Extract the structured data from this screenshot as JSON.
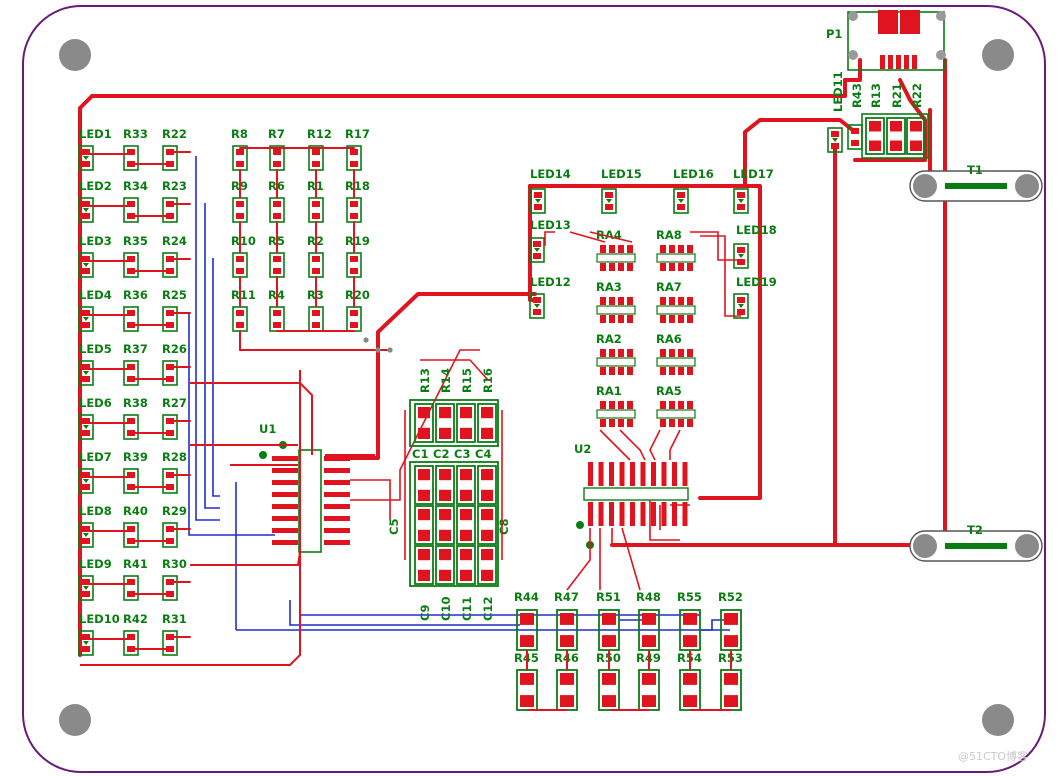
{
  "colors": {
    "outline": "#6a1b7a",
    "trace_top": "#e0141e",
    "trace_bottom": "#1f2fd0",
    "silk": "#0a7d12",
    "hole": "#8a8a8a",
    "pad": "#e0141e",
    "background": "#ffffff"
  },
  "left_column": {
    "leds": [
      "LED1",
      "LED2",
      "LED3",
      "LED4",
      "LED5",
      "LED6",
      "LED7",
      "LED8",
      "LED9",
      "LED10"
    ],
    "res_a": [
      "R33",
      "R34",
      "R35",
      "R36",
      "R37",
      "R38",
      "R39",
      "R40",
      "R41",
      "R42"
    ],
    "res_b": [
      "R22",
      "R23",
      "R24",
      "R25",
      "R26",
      "R27",
      "R28",
      "R29",
      "R30",
      "R31"
    ]
  },
  "resistor_grid": {
    "col1": [
      "R8",
      "R9",
      "R10",
      "R11"
    ],
    "col2": [
      "R7",
      "R6",
      "R5",
      "R4"
    ],
    "col3": [
      "R12",
      "R1",
      "R2",
      "R3"
    ],
    "col4": [
      "R17",
      "R18",
      "R19",
      "R20"
    ]
  },
  "ic": {
    "u1": "U1",
    "u2": "U2"
  },
  "center_block": {
    "top_res": [
      "R13",
      "R14",
      "R15",
      "R16"
    ],
    "caps_top": [
      "C1",
      "C2",
      "C3",
      "C4"
    ],
    "caps_bottom": [
      "C9",
      "C10",
      "C11",
      "C12"
    ],
    "side_left": "C5",
    "side_right": "C8"
  },
  "right_leds": {
    "top": [
      "LED14",
      "LED15",
      "LED16",
      "LED17"
    ],
    "left": [
      "LED13",
      "LED12"
    ],
    "right": [
      "LED18",
      "LED19"
    ]
  },
  "arrays": {
    "left": [
      "RA4",
      "RA3",
      "RA2",
      "RA1"
    ],
    "right": [
      "RA8",
      "RA7",
      "RA6",
      "RA5"
    ]
  },
  "bottom_res": {
    "top": [
      "R44",
      "R47",
      "R51",
      "R48",
      "R55",
      "R52"
    ],
    "bottom": [
      "R45",
      "R46",
      "R50",
      "R49",
      "R54",
      "R53"
    ]
  },
  "connector": {
    "p1": "P1",
    "led11": "LED11",
    "res": [
      "R43",
      "R13",
      "R21",
      "R22"
    ],
    "t1": "T1",
    "t2": "T2"
  },
  "watermark": "@51CTO博客"
}
